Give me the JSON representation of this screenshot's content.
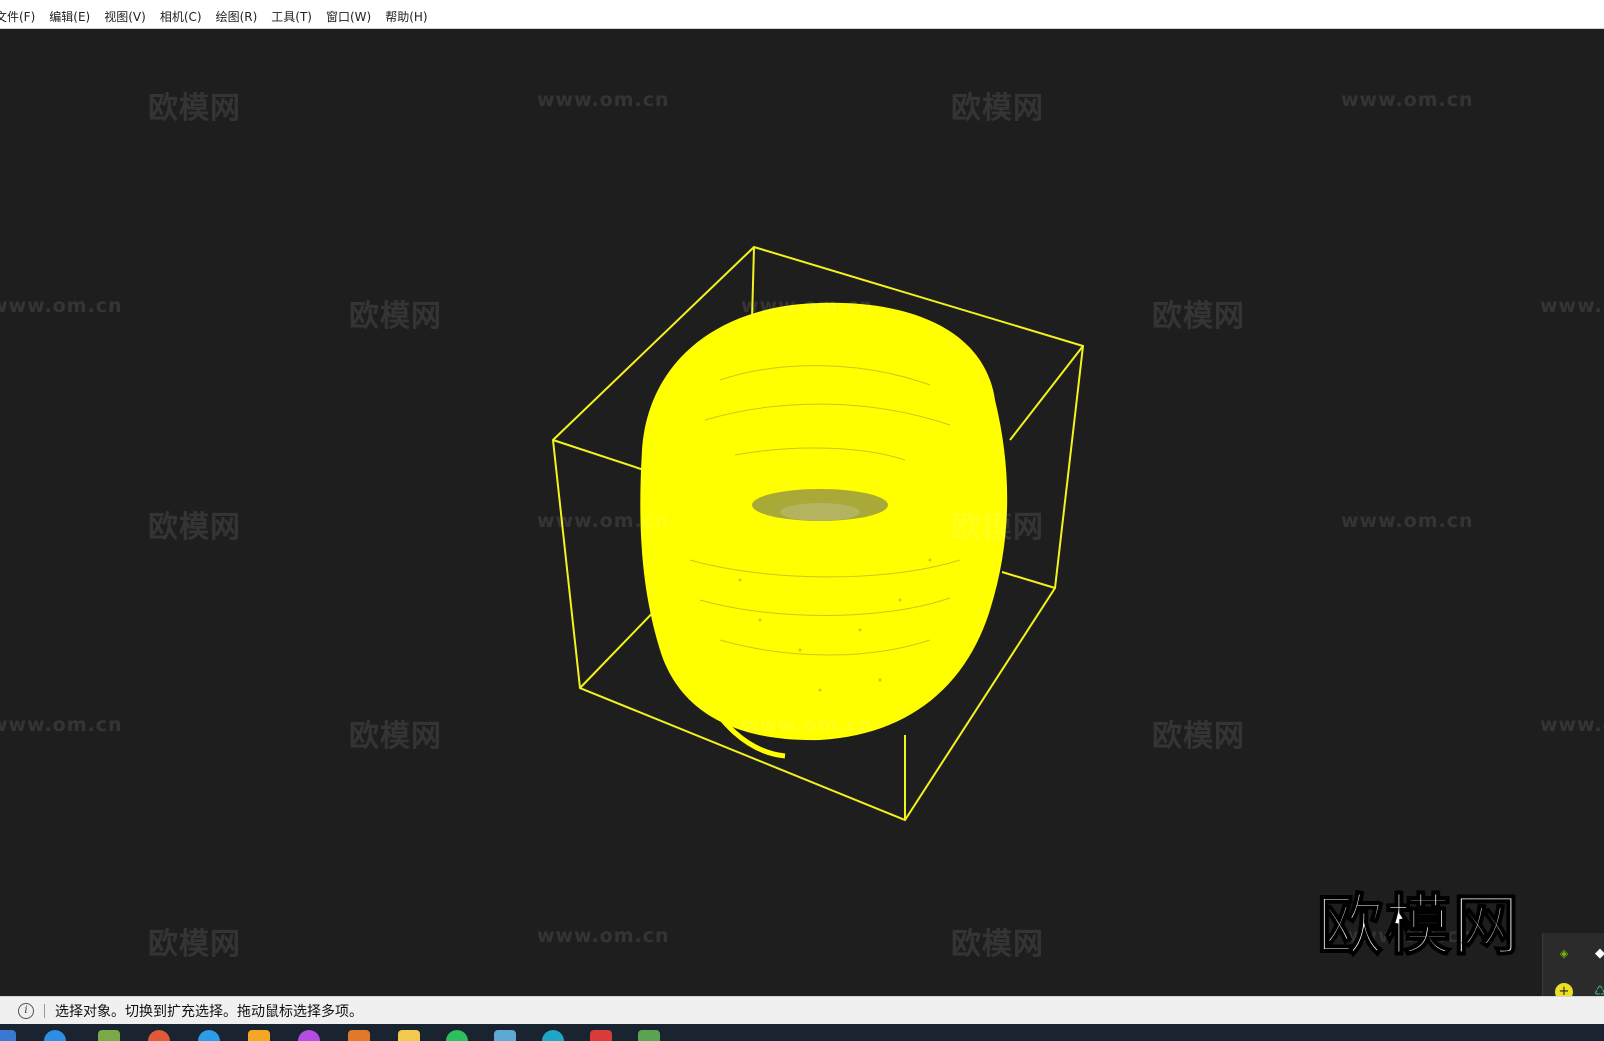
{
  "window": {
    "title": ""
  },
  "menu": {
    "items": [
      "文件(F)",
      "编辑(E)",
      "视图(V)",
      "相机(C)",
      "绘图(R)",
      "工具(T)",
      "窗口(W)",
      "帮助(H)"
    ]
  },
  "viewport": {
    "background": "#1e1e1e",
    "selection_color": "#ffff00",
    "watermark_text": "欧模网",
    "watermark_url": "www.om.cn",
    "logo_text": "欧模网"
  },
  "status": {
    "message": "选择对象。切换到扩充选择。拖动鼠标选择多项。"
  },
  "taskbar": {
    "icons": [
      "start-icon",
      "edge-icon",
      "app-icon",
      "chrome-icon",
      "browser-icon",
      "store-icon",
      "office-icon",
      "app2-icon",
      "folder-icon",
      "wechat-icon",
      "app3-icon",
      "app4-icon",
      "app5-icon",
      "app6-icon"
    ]
  },
  "tray": {
    "icons": [
      "nvidia-icon",
      "shield-icon",
      "add-icon",
      "recycle-icon",
      "flag-icon"
    ]
  }
}
